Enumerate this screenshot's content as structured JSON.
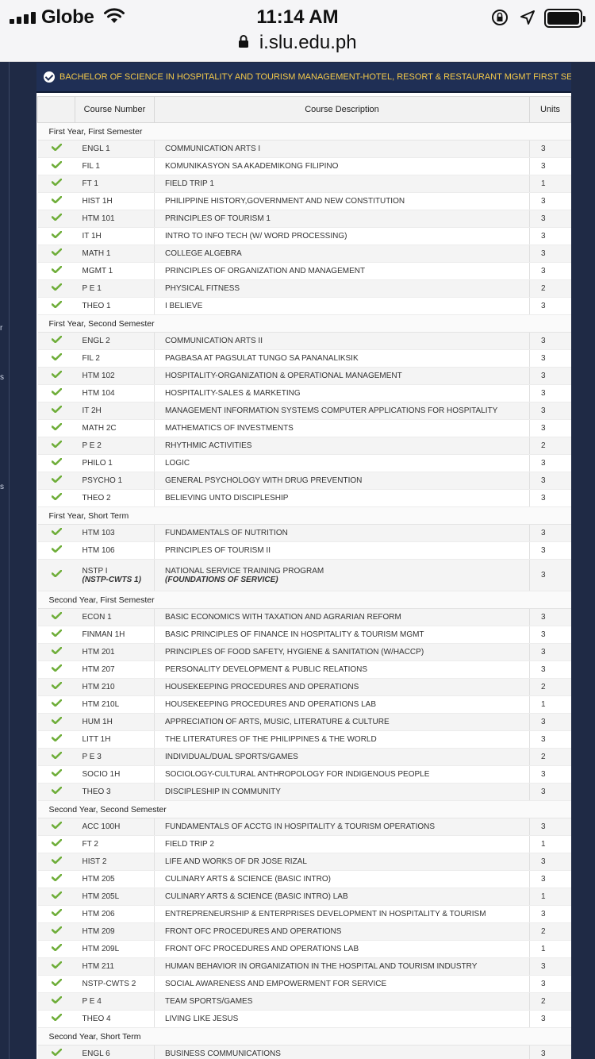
{
  "status_bar": {
    "carrier": "Globe",
    "time": "11:14 AM"
  },
  "browser": {
    "url": "i.slu.edu.ph"
  },
  "side_letters": [
    "r",
    "s",
    "s"
  ],
  "colors": {
    "header_bg": "#1f2f55",
    "header_text": "#f3c94a",
    "check_green": "#6fae3a"
  },
  "program": {
    "title": "BACHELOR OF SCIENCE IN HOSPITALITY AND TOURISM MANAGEMENT-HOTEL, RESORT & RESTAURANT MGMT FIRST SE..."
  },
  "table": {
    "headers": {
      "course_number": "Course Number",
      "course_description": "Course Description",
      "units": "Units"
    },
    "semesters": [
      {
        "name": "First Year, First Semester",
        "courses": [
          {
            "number": "ENGL 1",
            "description": "COMMUNICATION ARTS I",
            "units": "3"
          },
          {
            "number": "FIL 1",
            "description": "KOMUNIKASYON SA AKADEMIKONG FILIPINO",
            "units": "3"
          },
          {
            "number": "FT 1",
            "description": "FIELD TRIP 1",
            "units": "1"
          },
          {
            "number": "HIST 1H",
            "description": "PHILIPPINE HISTORY,GOVERNMENT AND NEW CONSTITUTION",
            "units": "3"
          },
          {
            "number": "HTM 101",
            "description": "PRINCIPLES OF TOURISM 1",
            "units": "3"
          },
          {
            "number": "IT 1H",
            "description": "INTRO TO INFO TECH (W/ WORD PROCESSING)",
            "units": "3"
          },
          {
            "number": "MATH 1",
            "description": "COLLEGE ALGEBRA",
            "units": "3"
          },
          {
            "number": "MGMT 1",
            "description": "PRINCIPLES OF ORGANIZATION AND MANAGEMENT",
            "units": "3"
          },
          {
            "number": "P E 1",
            "description": "PHYSICAL FITNESS",
            "units": "2"
          },
          {
            "number": "THEO 1",
            "description": "I BELIEVE",
            "units": "3"
          }
        ]
      },
      {
        "name": "First Year, Second Semester",
        "courses": [
          {
            "number": "ENGL 2",
            "description": "COMMUNICATION ARTS II",
            "units": "3"
          },
          {
            "number": "FIL 2",
            "description": "PAGBASA AT PAGSULAT TUNGO SA PANANALIKSIK",
            "units": "3"
          },
          {
            "number": "HTM 102",
            "description": "HOSPITALITY-ORGANIZATION & OPERATIONAL MANAGEMENT",
            "units": "3"
          },
          {
            "number": "HTM 104",
            "description": "HOSPITALITY-SALES & MARKETING",
            "units": "3"
          },
          {
            "number": "IT 2H",
            "description": "MANAGEMENT INFORMATION SYSTEMS COMPUTER APPLICATIONS FOR HOSPITALITY",
            "units": "3"
          },
          {
            "number": "MATH 2C",
            "description": "MATHEMATICS OF INVESTMENTS",
            "units": "3"
          },
          {
            "number": "P E 2",
            "description": "RHYTHMIC ACTIVITIES",
            "units": "2"
          },
          {
            "number": "PHILO 1",
            "description": "LOGIC",
            "units": "3"
          },
          {
            "number": "PSYCHO 1",
            "description": "GENERAL PSYCHOLOGY WITH DRUG PREVENTION",
            "units": "3"
          },
          {
            "number": "THEO 2",
            "description": "BELIEVING UNTO DISCIPLESHIP",
            "units": "3"
          }
        ]
      },
      {
        "name": "First Year, Short Term",
        "courses": [
          {
            "number": "HTM 103",
            "description": "FUNDAMENTALS OF NUTRITION",
            "units": "3"
          },
          {
            "number": "HTM 106",
            "description": "PRINCIPLES OF TOURISM II",
            "units": "3"
          },
          {
            "number": "NSTP I",
            "number_sub": "(NSTP-CWTS 1)",
            "description": "NATIONAL SERVICE TRAINING PROGRAM",
            "description_sub": "(FOUNDATIONS OF SERVICE)",
            "units": "3"
          }
        ]
      },
      {
        "name": "Second Year, First Semester",
        "courses": [
          {
            "number": "ECON 1",
            "description": "BASIC ECONOMICS WITH TAXATION AND AGRARIAN REFORM",
            "units": "3"
          },
          {
            "number": "FINMAN 1H",
            "description": "BASIC PRINCIPLES OF FINANCE IN HOSPITALITY & TOURISM MGMT",
            "units": "3"
          },
          {
            "number": "HTM 201",
            "description": "PRINCIPLES OF FOOD SAFETY, HYGIENE & SANITATION (W/HACCP)",
            "units": "3"
          },
          {
            "number": "HTM 207",
            "description": "PERSONALITY DEVELOPMENT & PUBLIC RELATIONS",
            "units": "3"
          },
          {
            "number": "HTM 210",
            "description": "HOUSEKEEPING PROCEDURES AND OPERATIONS",
            "units": "2"
          },
          {
            "number": "HTM 210L",
            "description": "HOUSEKEEPING PROCEDURES AND OPERATIONS LAB",
            "units": "1"
          },
          {
            "number": "HUM 1H",
            "description": "APPRECIATION OF ARTS, MUSIC, LITERATURE & CULTURE",
            "units": "3"
          },
          {
            "number": "LITT 1H",
            "description": "THE LITERATURES OF THE PHILIPPINES & THE WORLD",
            "units": "3"
          },
          {
            "number": "P E 3",
            "description": "INDIVIDUAL/DUAL SPORTS/GAMES",
            "units": "2"
          },
          {
            "number": "SOCIO 1H",
            "description": "SOCIOLOGY-CULTURAL ANTHROPOLOGY FOR INDIGENOUS PEOPLE",
            "units": "3"
          },
          {
            "number": "THEO 3",
            "description": "DISCIPLESHIP IN COMMUNITY",
            "units": "3"
          }
        ]
      },
      {
        "name": "Second Year, Second Semester",
        "courses": [
          {
            "number": "ACC 100H",
            "description": "FUNDAMENTALS OF ACCTG IN HOSPITALITY & TOURISM OPERATIONS",
            "units": "3"
          },
          {
            "number": "FT 2",
            "description": "FIELD TRIP 2",
            "units": "1"
          },
          {
            "number": "HIST 2",
            "description": "LIFE AND WORKS OF DR JOSE RIZAL",
            "units": "3"
          },
          {
            "number": "HTM 205",
            "description": "CULINARY ARTS & SCIENCE (BASIC INTRO)",
            "units": "3"
          },
          {
            "number": "HTM 205L",
            "description": "CULINARY ARTS & SCIENCE (BASIC INTRO) LAB",
            "units": "1"
          },
          {
            "number": "HTM 206",
            "description": "ENTREPRENEURSHIP & ENTERPRISES DEVELOPMENT IN HOSPITALITY & TOURISM",
            "units": "3"
          },
          {
            "number": "HTM 209",
            "description": "FRONT OFC PROCEDURES AND OPERATIONS",
            "units": "2"
          },
          {
            "number": "HTM 209L",
            "description": "FRONT OFC PROCEDURES AND OPERATIONS LAB",
            "units": "1"
          },
          {
            "number": "HTM 211",
            "description": "HUMAN BEHAVIOR IN ORGANIZATION IN THE HOSPITAL AND TOURISM INDUSTRY",
            "units": "3"
          },
          {
            "number": "NSTP-CWTS 2",
            "description": "SOCIAL AWARENESS AND EMPOWERMENT FOR SERVICE",
            "units": "3"
          },
          {
            "number": "P E 4",
            "description": "TEAM SPORTS/GAMES",
            "units": "2"
          },
          {
            "number": "THEO 4",
            "description": "LIVING LIKE JESUS",
            "units": "3"
          }
        ]
      },
      {
        "name": "Second Year, Short Term",
        "courses": [
          {
            "number": "ENGL 6",
            "description": "BUSINESS COMMUNICATIONS",
            "units": "3"
          }
        ]
      }
    ]
  }
}
